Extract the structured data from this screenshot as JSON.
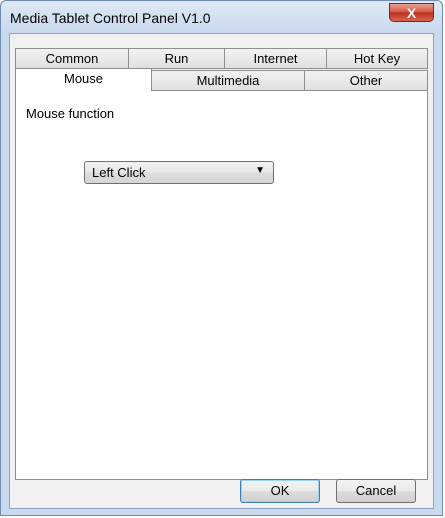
{
  "window": {
    "title": "Media Tablet Control Panel V1.0",
    "close_symbol": "X"
  },
  "tabs_row1": [
    {
      "label": "Common"
    },
    {
      "label": "Run"
    },
    {
      "label": "Internet"
    },
    {
      "label": "Hot Key"
    }
  ],
  "tabs_row2": [
    {
      "label": "Mouse",
      "active": true
    },
    {
      "label": "Multimedia"
    },
    {
      "label": "Other"
    }
  ],
  "panel": {
    "mouse_function_label": "Mouse function",
    "mouse_function_value": "Left Click",
    "dropdown_arrow": "▼"
  },
  "buttons": {
    "ok": "OK",
    "cancel": "Cancel"
  }
}
